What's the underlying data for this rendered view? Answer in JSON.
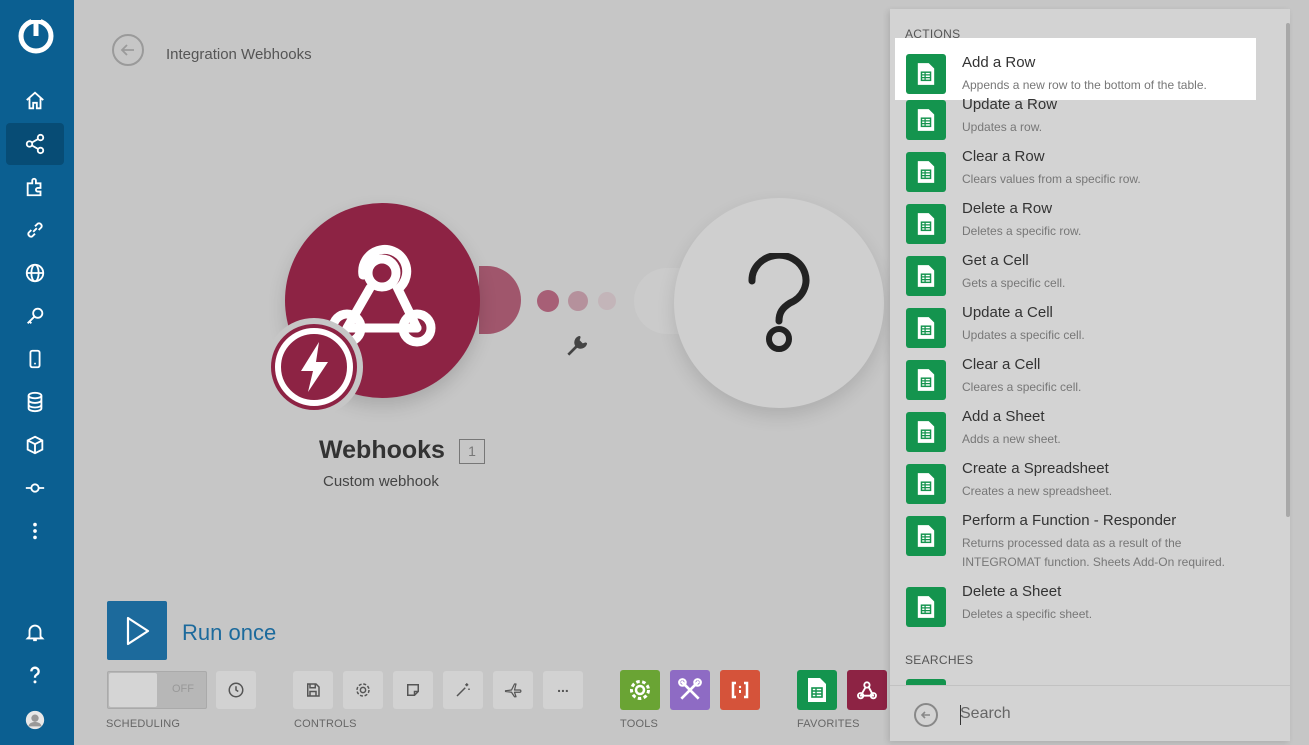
{
  "breadcrumb": {
    "title": "Integration Webhooks"
  },
  "sidebar": {
    "items": [
      {
        "icon": "home-icon"
      },
      {
        "icon": "share-icon",
        "active": true
      },
      {
        "icon": "puzzle-icon"
      },
      {
        "icon": "link-icon"
      },
      {
        "icon": "globe-icon"
      },
      {
        "icon": "key-icon"
      },
      {
        "icon": "phone-icon"
      },
      {
        "icon": "database-icon"
      },
      {
        "icon": "cube-icon"
      },
      {
        "icon": "flow-icon"
      },
      {
        "icon": "more-icon"
      }
    ],
    "bottom": [
      {
        "icon": "bell-icon"
      },
      {
        "icon": "help-icon"
      },
      {
        "icon": "avatar"
      }
    ]
  },
  "scenario": {
    "module_name": "Webhooks",
    "module_count": "1",
    "module_subtitle": "Custom webhook",
    "placeholder_icon": "question-icon"
  },
  "toolbar": {
    "run_label": "Run once",
    "toggle_label": "OFF",
    "sections": {
      "scheduling": "SCHEDULING",
      "controls": "CONTROLS",
      "tools": "TOOLS",
      "favorites": "FAVORITES"
    },
    "more_label": "...",
    "colors": {
      "run": "#1c6a9c",
      "tools_green": "#6aa434",
      "tools_purple": "#8e6bc4",
      "tools_red": "#d5533a",
      "sheets": "#14944e",
      "webhooks": "#8d2344"
    }
  },
  "panel": {
    "actions_heading": "ACTIONS",
    "searches_heading": "SEARCHES",
    "search_placeholder": "Search",
    "actions": [
      {
        "title": "Add a Row",
        "desc": "Appends a new row to the bottom of the table."
      },
      {
        "title": "Update a Row",
        "desc": "Updates a row."
      },
      {
        "title": "Clear a Row",
        "desc": "Clears values from a specific row."
      },
      {
        "title": "Delete a Row",
        "desc": "Deletes a specific row."
      },
      {
        "title": "Get a Cell",
        "desc": "Gets a specific cell."
      },
      {
        "title": "Update a Cell",
        "desc": "Updates a specific cell."
      },
      {
        "title": "Clear a Cell",
        "desc": "Cleares a specific cell."
      },
      {
        "title": "Add a Sheet",
        "desc": "Adds a new sheet."
      },
      {
        "title": "Create a Spreadsheet",
        "desc": "Creates a new spreadsheet."
      },
      {
        "title": "Perform a Function - Responder",
        "desc": "Returns processed data as a result of the INTEGROMAT function. Sheets Add-On required."
      },
      {
        "title": "Delete a Sheet",
        "desc": "Deletes a specific sheet."
      }
    ]
  }
}
